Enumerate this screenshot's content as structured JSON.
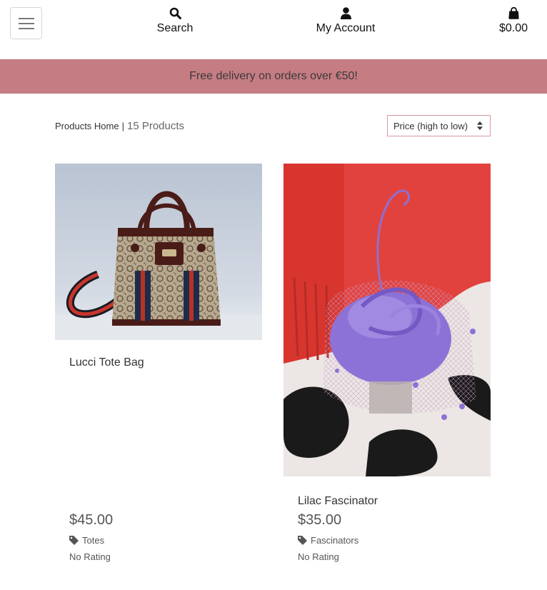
{
  "header": {
    "search_label": "Search",
    "account_label": "My Account",
    "bag_total": "$0.00"
  },
  "banner": {
    "text": "Free delivery on orders over €50!",
    "color": "#c57c82"
  },
  "toolbar": {
    "breadcrumb_home": "Products Home",
    "separator": "|",
    "product_count": "15 Products",
    "sort_selected": "Price (high to low)"
  },
  "products": [
    {
      "name": "Lucci Tote Bag",
      "price": "$45.00",
      "category": "Totes",
      "rating": "No Rating",
      "image_icon": "tote-bag-photo"
    },
    {
      "name": "Lilac Fascinator",
      "price": "$35.00",
      "category": "Fascinators",
      "rating": "No Rating",
      "image_icon": "fascinator-photo"
    }
  ]
}
